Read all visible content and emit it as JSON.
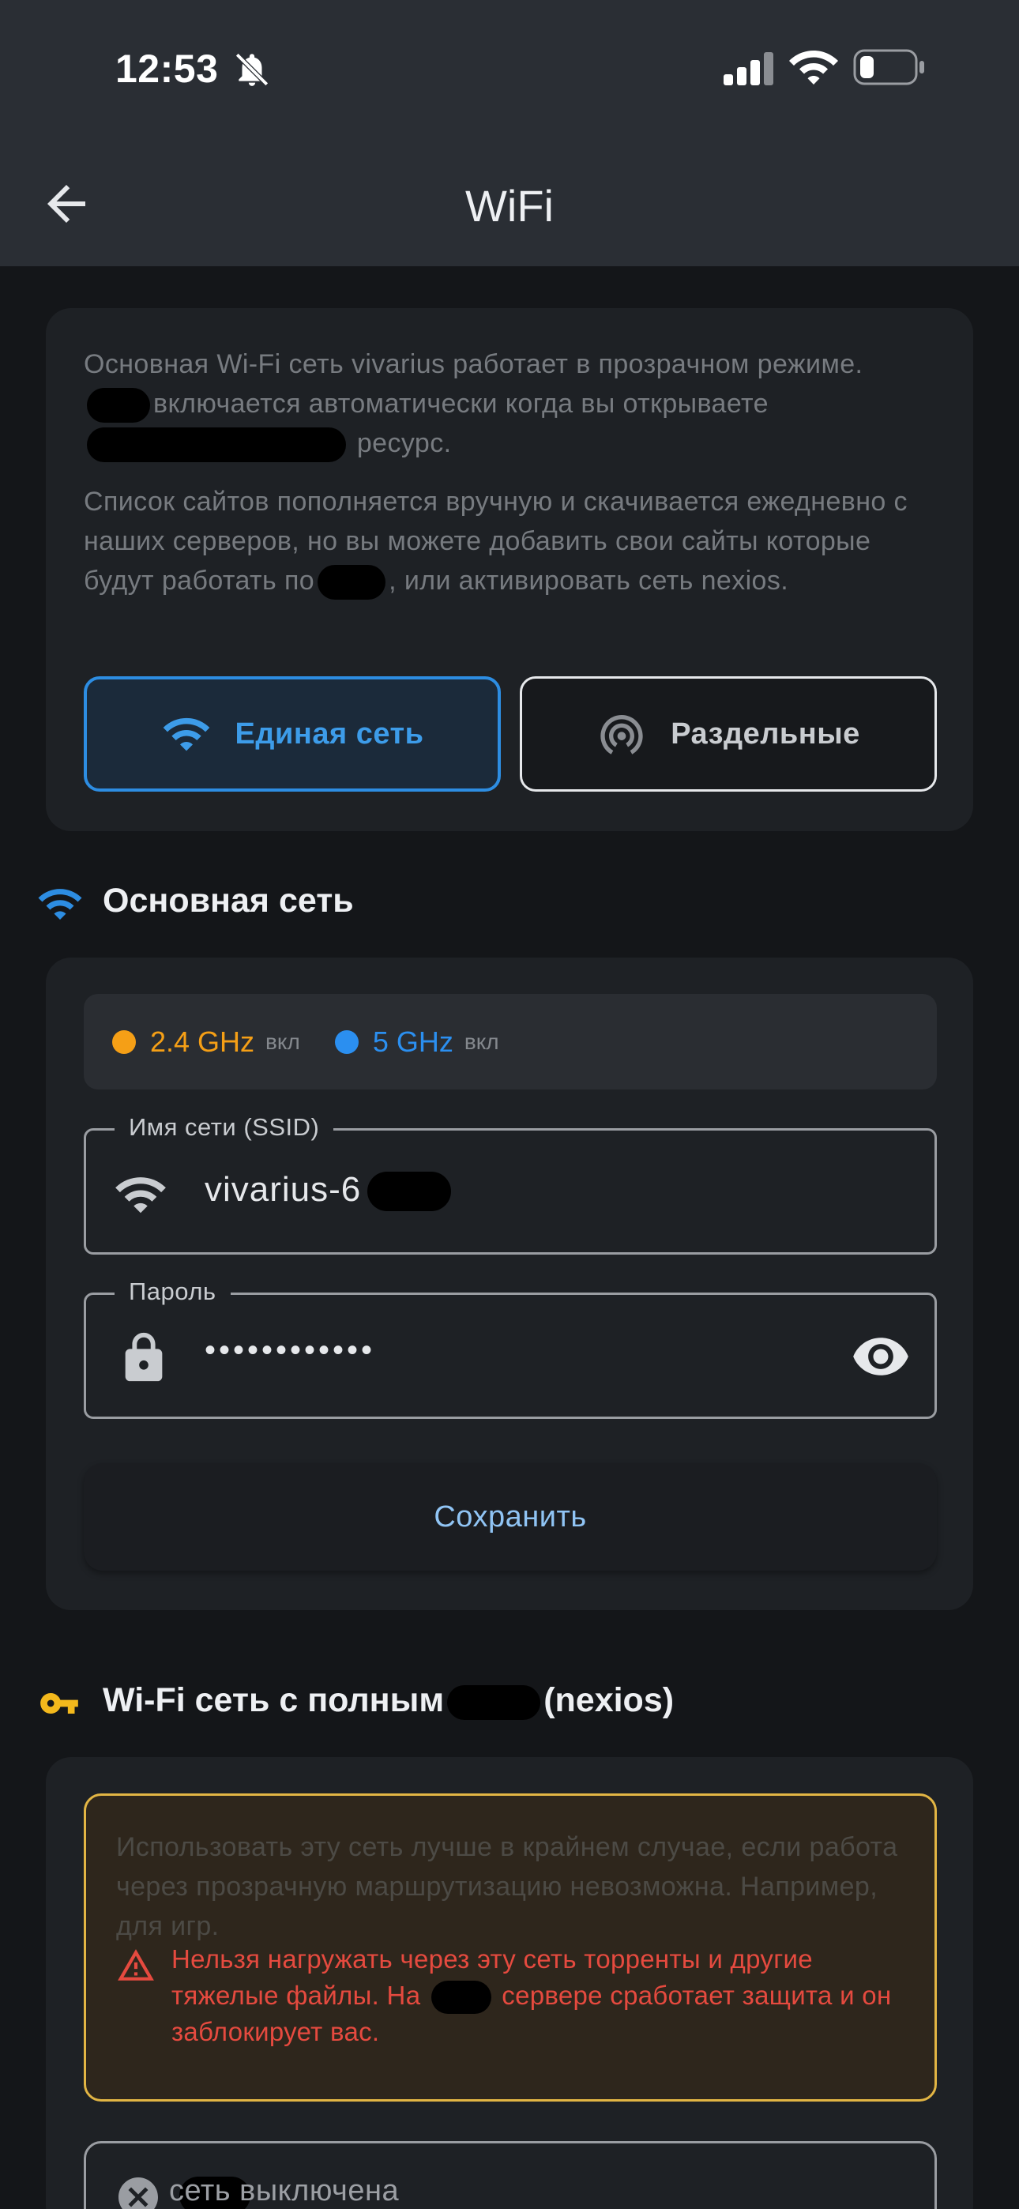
{
  "status_bar": {
    "time": "12:53",
    "icons": [
      "bell-slash-icon",
      "signal-icon",
      "wifi-icon",
      "battery-icon"
    ]
  },
  "app_bar": {
    "title": "WiFi",
    "back_icon": "arrow-left-icon"
  },
  "info_card": {
    "para1_a": "Основная Wi-Fi сеть vivarius работает в прозрачном режиме.",
    "para1_b": "включается автоматически когда вы открываете",
    "para1_c": "ресурс.",
    "para2_a": "Список сайтов пополняется вручную и скачивается ежедневно с наших серверов, но вы можете добавить свои сайты которые будут работать по",
    "para2_b": ", или активировать сеть nexios.",
    "mode_single_label": "Единая сеть",
    "mode_split_label": "Раздельные",
    "selected_mode": "single"
  },
  "main_network": {
    "title": "Основная сеть",
    "bands": [
      {
        "name": "2.4 GHz",
        "state": "вкл",
        "color": "#f59f16"
      },
      {
        "name": "5 GHz",
        "state": "вкл",
        "color": "#2b8ff0"
      }
    ],
    "ssid_label": "Имя сети (SSID)",
    "ssid_value": "vivarius-6",
    "password_label": "Пароль",
    "password_value": "••••••••••••",
    "save_label": "Сохранить"
  },
  "full_network": {
    "title_a": "Wi-Fi сеть с полным",
    "title_b": "(nexios)",
    "warn_muted": "Использовать эту сеть лучше в крайнем случае, если работа через прозрачную маршрутизацию невозможна. Например, для игр.",
    "warn_alert_a": "Нельзя нагружать через эту сеть торренты и другие тяжелые файлы. На",
    "warn_alert_b": "сервере сработает защита и он заблокирует вас.",
    "status_text": "сеть выключена"
  },
  "colors": {
    "accent": "#2d8de2",
    "warning_border": "#e2b544",
    "danger": "#e54a3f",
    "key_icon": "#f3b81c"
  }
}
